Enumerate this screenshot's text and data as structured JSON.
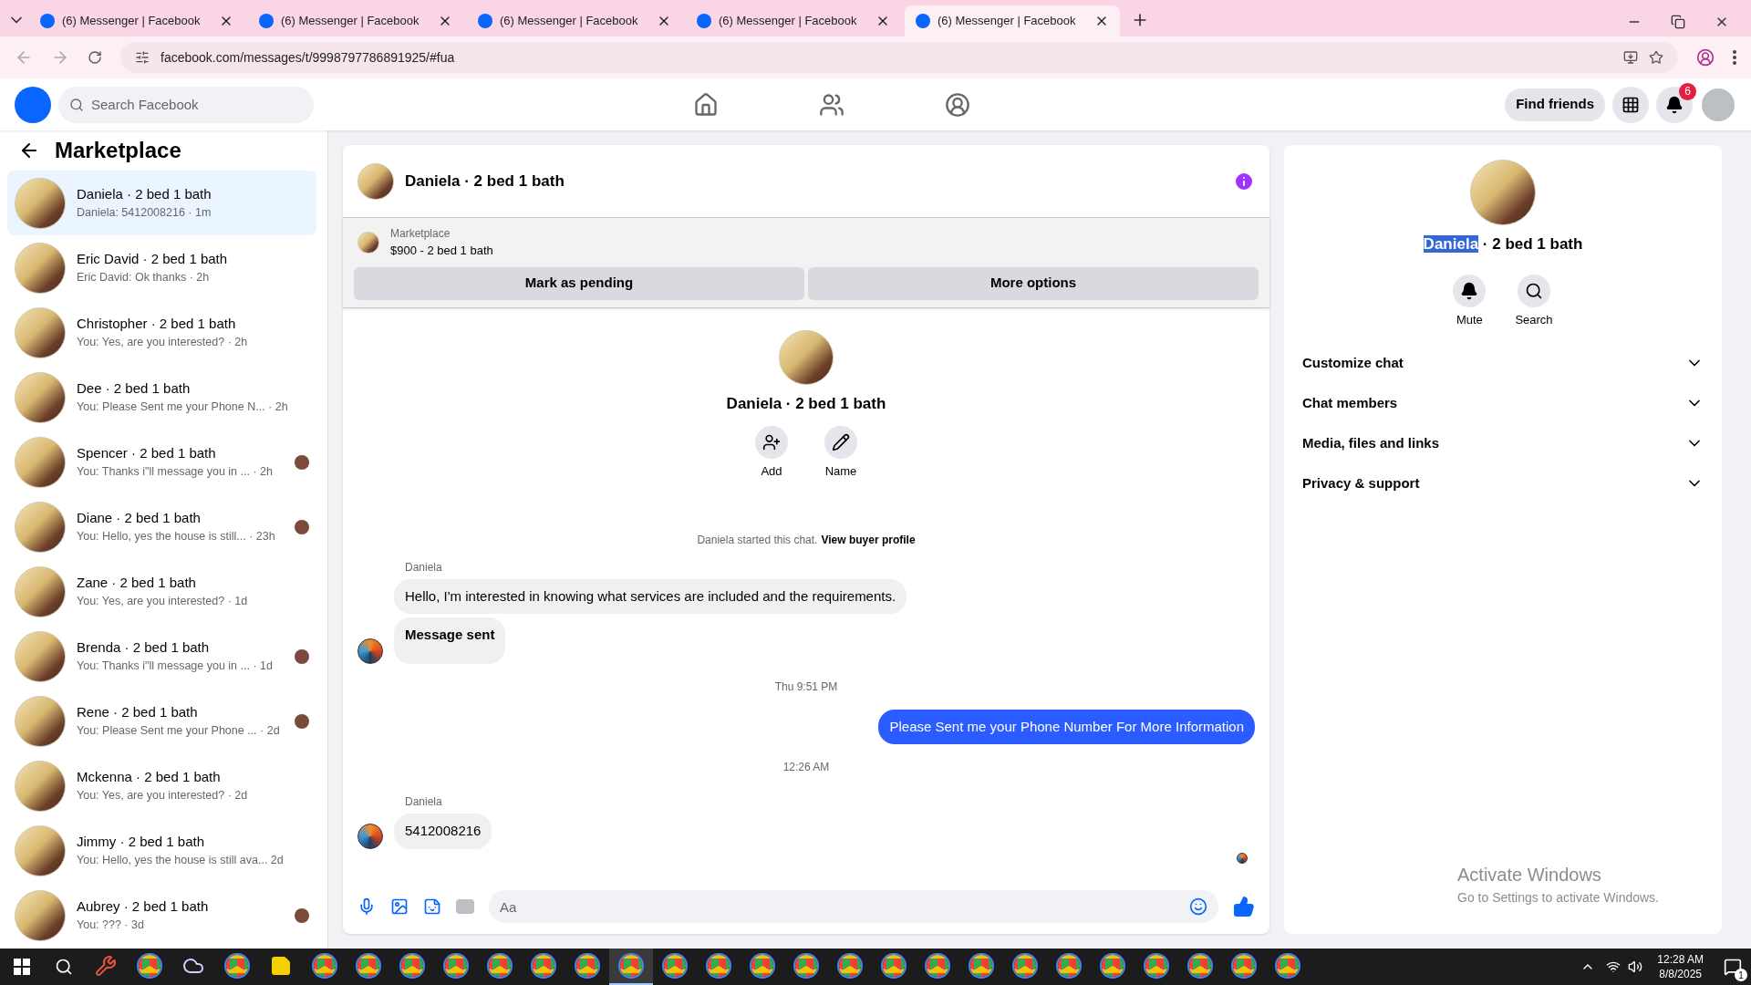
{
  "browser": {
    "tabs": [
      {
        "title": "(6) Messenger | Facebook",
        "selected": false
      },
      {
        "title": "(6) Messenger | Facebook",
        "selected": false
      },
      {
        "title": "(6) Messenger | Facebook",
        "selected": false
      },
      {
        "title": "(6) Messenger | Facebook",
        "selected": false
      },
      {
        "title": "(6) Messenger | Facebook",
        "selected": true
      }
    ],
    "url": "facebook.com/messages/t/9998797786891925/#fua"
  },
  "header": {
    "search_placeholder": "Search Facebook",
    "nav": [
      {
        "kind": "home"
      },
      {
        "kind": "friends"
      },
      {
        "kind": "groups"
      }
    ],
    "find_friends": "Find friends",
    "notification_count": "6"
  },
  "sidebar": {
    "title": "Marketplace",
    "conversations": [
      {
        "title": "Daniela · 2 bed 1 bath",
        "preview": "Daniela: 5412008216 · 1m",
        "selected": true,
        "seen_avatar": false
      },
      {
        "title": "Eric David · 2 bed 1 bath",
        "preview": "Eric David: Ok thanks · 2h",
        "selected": false,
        "seen_avatar": false
      },
      {
        "title": "Christopher · 2 bed 1 bath",
        "preview": "You: Yes, are you interested? · 2h",
        "selected": false,
        "seen_avatar": false
      },
      {
        "title": "Dee · 2 bed 1 bath",
        "preview": "You: Please Sent me your Phone N...  · 2h",
        "selected": false,
        "seen_avatar": false
      },
      {
        "title": "Spencer · 2 bed 1 bath",
        "preview": "You: Thanks i\"ll message you in ...  · 2h",
        "selected": false,
        "seen_avatar": true
      },
      {
        "title": "Diane · 2 bed 1 bath",
        "preview": "You: Hello, yes the house is still... · 23h",
        "selected": false,
        "seen_avatar": true
      },
      {
        "title": "Zane · 2 bed 1 bath",
        "preview": "You: Yes, are you interested? · 1d",
        "selected": false,
        "seen_avatar": false
      },
      {
        "title": "Brenda · 2 bed 1 bath",
        "preview": "You: Thanks i\"ll message you in ...  · 1d",
        "selected": false,
        "seen_avatar": true
      },
      {
        "title": "Rene · 2 bed 1 bath",
        "preview": "You: Please Sent me your Phone ... · 2d",
        "selected": false,
        "seen_avatar": true
      },
      {
        "title": "Mckenna · 2 bed 1 bath",
        "preview": "You: Yes, are you interested? · 2d",
        "selected": false,
        "seen_avatar": false
      },
      {
        "title": "Jimmy · 2 bed 1 bath",
        "preview": "You: Hello, yes the house is still ava...  2d",
        "selected": false,
        "seen_avatar": false
      },
      {
        "title": "Aubrey · 2 bed 1 bath",
        "preview": "You: ??? · 3d",
        "selected": false,
        "seen_avatar": true
      }
    ]
  },
  "chat": {
    "title": "Daniela · 2 bed 1 bath",
    "listing": {
      "label": "Marketplace",
      "item": "$900 - 2 bed 1 bath",
      "buttons": [
        "Mark as pending",
        "More options"
      ]
    },
    "intro": {
      "title": "Daniela · 2 bed 1 bath",
      "actions": [
        {
          "kind": "add",
          "label": "Add"
        },
        {
          "kind": "name",
          "label": "Name"
        }
      ],
      "started": "Daniela started this chat.",
      "link": "View buyer profile"
    },
    "messages": [
      {
        "kind": "sender",
        "text": "Daniela"
      },
      {
        "kind": "incoming",
        "text": "Hello, I'm interested in knowing what services are included and the requirements.",
        "avatar": false,
        "bold": false
      },
      {
        "kind": "incoming",
        "text": "Message sent",
        "avatar": true,
        "bold": true
      },
      {
        "kind": "timestamp",
        "text": "Thu 9:51 PM"
      },
      {
        "kind": "outgoing",
        "text": "Please Sent me your Phone Number For More Information"
      },
      {
        "kind": "timestamp",
        "text": "12:26 AM"
      },
      {
        "kind": "sender",
        "text": "Daniela"
      },
      {
        "kind": "incoming",
        "text": "5412008216",
        "avatar": true,
        "bold": false
      },
      {
        "kind": "seen"
      }
    ],
    "composer_placeholder": "Aa"
  },
  "details": {
    "title_parts": [
      {
        "text": "Daniela",
        "selected": true
      },
      {
        "text": " · 2 bed 1 bath",
        "selected": false
      }
    ],
    "actions": [
      {
        "kind": "mute",
        "label": "Mute"
      },
      {
        "kind": "search",
        "label": "Search"
      }
    ],
    "sections": [
      "Customize chat",
      "Chat members",
      "Media, files and links",
      "Privacy & support"
    ]
  },
  "windows_notice": {
    "title": "Activate Windows",
    "subtitle": "Go to Settings to activate Windows."
  },
  "taskbar": {
    "apps": [
      {
        "kind": "tool",
        "selected": false
      },
      {
        "kind": "chrome",
        "selected": false
      },
      {
        "kind": "cloud",
        "selected": false
      },
      {
        "kind": "chrome",
        "selected": false
      },
      {
        "kind": "notes",
        "selected": false
      },
      {
        "kind": "chrome",
        "selected": false
      },
      {
        "kind": "chrome",
        "selected": false
      },
      {
        "kind": "chrome",
        "selected": false
      },
      {
        "kind": "chrome",
        "selected": false
      },
      {
        "kind": "chrome",
        "selected": false
      },
      {
        "kind": "chrome",
        "selected": false
      },
      {
        "kind": "chrome",
        "selected": false
      },
      {
        "kind": "chrome",
        "selected": true
      },
      {
        "kind": "chrome",
        "selected": false
      },
      {
        "kind": "chrome",
        "selected": false
      },
      {
        "kind": "chrome",
        "selected": false
      },
      {
        "kind": "chrome",
        "selected": false
      },
      {
        "kind": "chrome",
        "selected": false
      },
      {
        "kind": "chrome",
        "selected": false
      },
      {
        "kind": "chrome",
        "selected": false
      },
      {
        "kind": "chrome",
        "selected": false
      },
      {
        "kind": "chrome",
        "selected": false
      },
      {
        "kind": "chrome",
        "selected": false
      },
      {
        "kind": "chrome",
        "selected": false
      },
      {
        "kind": "chrome",
        "selected": false
      },
      {
        "kind": "chrome",
        "selected": false
      },
      {
        "kind": "chrome",
        "selected": false
      },
      {
        "kind": "chrome",
        "selected": false
      }
    ],
    "time": "12:28 AM",
    "date": "8/8/2025",
    "notifications": "1"
  }
}
